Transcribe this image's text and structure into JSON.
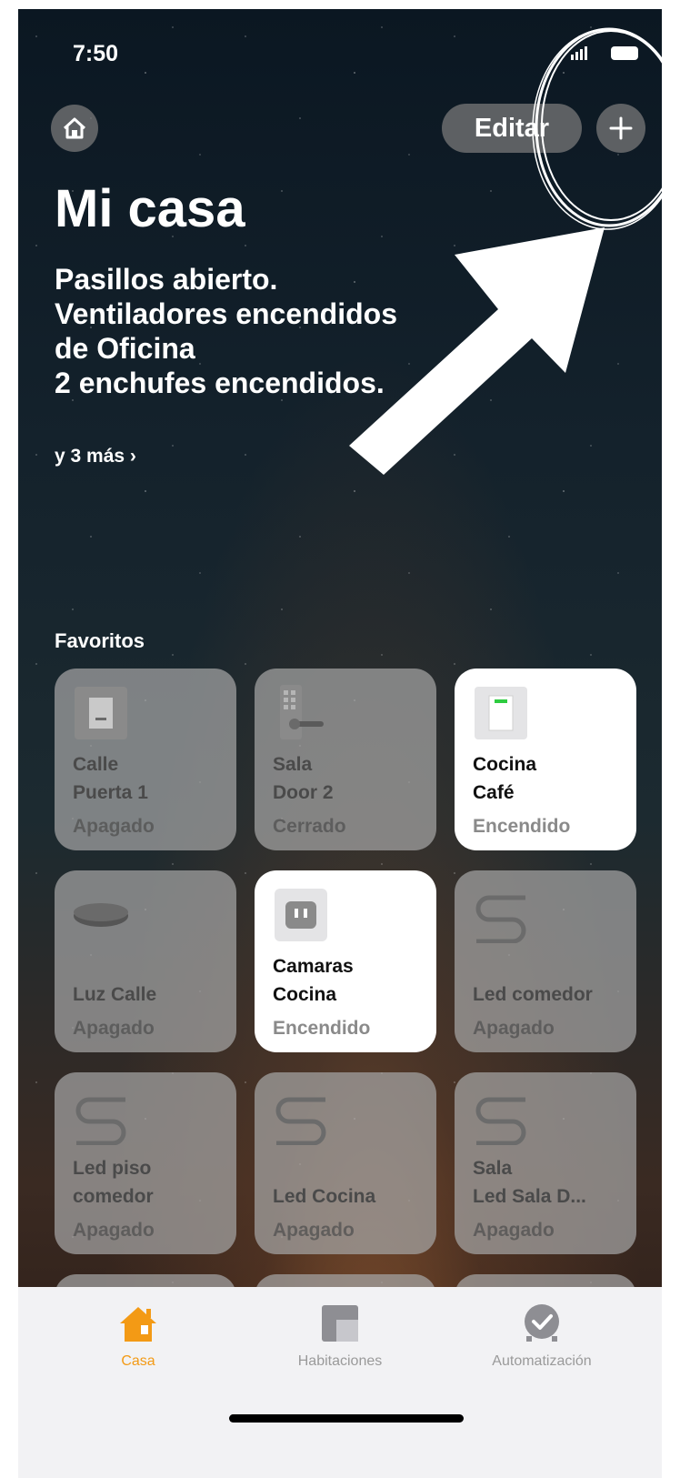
{
  "status": {
    "time": "7:50"
  },
  "header": {
    "edit_label": "Editar"
  },
  "home": {
    "title": "Mi casa",
    "summary": [
      "Pasillos abierto.",
      "Ventiladores encendidos",
      "de Oficina",
      "2 enchufes encendidos."
    ],
    "more": "y 3 más ›"
  },
  "favorites": {
    "label": "Favoritos",
    "tiles": [
      {
        "name": "Calle\nPuerta 1",
        "state": "Apagado",
        "icon": "door-switch-icon",
        "on": false
      },
      {
        "name": "Sala\nDoor 2",
        "state": "Cerrado",
        "icon": "smart-lock-icon",
        "on": false
      },
      {
        "name": "Cocina\nCafé",
        "state": "Encendido",
        "icon": "switch-on-icon",
        "on": true
      },
      {
        "name": "Luz Calle",
        "state": "Apagado",
        "icon": "ceiling-light-icon",
        "on": false
      },
      {
        "name": "Camaras\nCocina",
        "state": "Encendido",
        "icon": "outlet-icon",
        "on": true
      },
      {
        "name": "Led comedor",
        "state": "Apagado",
        "icon": "led-strip-icon",
        "on": false
      },
      {
        "name": "Led piso\ncomedor",
        "state": "Apagado",
        "icon": "led-strip-icon",
        "on": false
      },
      {
        "name": "Led Cocina",
        "state": "Apagado",
        "icon": "led-strip-icon",
        "on": false
      },
      {
        "name": "Sala\nLed Sala D...",
        "state": "Apagado",
        "icon": "led-strip-icon",
        "on": false
      }
    ]
  },
  "tabbar": {
    "tabs": [
      {
        "label": "Casa",
        "icon": "house-icon",
        "active": true
      },
      {
        "label": "Habitaciones",
        "icon": "rooms-icon",
        "active": false
      },
      {
        "label": "Automatización",
        "icon": "automation-icon",
        "active": false
      }
    ]
  },
  "colors": {
    "accent": "#f39a15",
    "tile_off": "#a5a5a5",
    "tile_on": "#ffffff"
  }
}
